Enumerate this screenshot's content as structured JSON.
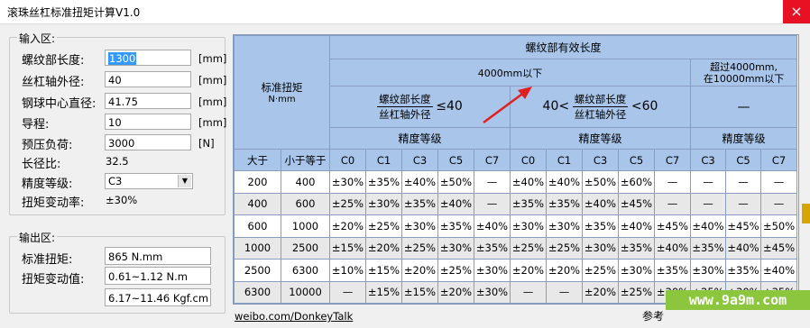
{
  "window": {
    "title": "滚珠丝杠标准扭矩计算V1.0",
    "close": "×"
  },
  "input_section": {
    "legend": "输入区:",
    "rows": [
      {
        "label": "螺纹部长度:",
        "value": "1300",
        "unit": "[mm]"
      },
      {
        "label": "丝杠轴外径:",
        "value": "40",
        "unit": "[mm]"
      },
      {
        "label": "钢球中心直径:",
        "value": "41.75",
        "unit": "[mm]"
      },
      {
        "label": "导程:",
        "value": "10",
        "unit": "[mm]"
      },
      {
        "label": "预压负荷:",
        "value": "3000",
        "unit": "[N]"
      }
    ],
    "ratio_label": "长径比:",
    "ratio_value": "32.5",
    "grade_label": "精度等级:",
    "grade_value": "C3",
    "torque_var_label": "扭矩变动率:",
    "torque_var_value": "±30%"
  },
  "output_section": {
    "legend": "输出区:",
    "std_torque_label": "标准扭矩:",
    "std_torque_value": "865 N.mm",
    "torque_range_label": "扭矩变动值:",
    "torque_range_value": "0.61~1.12 N.m",
    "torque_range_value2": "6.17~11.46 Kgf.cm"
  },
  "table": {
    "std_torque_head": "标准扭矩",
    "std_torque_unit": "N·mm",
    "effective_length": "螺纹部有效长度",
    "under_4000": "4000mm以下",
    "over_4000_line1": "超过4000mm,",
    "over_4000_line2": "在10000mm以下",
    "frac_num": "螺纹部长度",
    "frac_den": "丝杠轴外径",
    "le40": "≤40",
    "lt60_prefix": "40<",
    "lt60_suffix": "<60",
    "dash_header": "—",
    "precision": "精度等级",
    "greater": "大于",
    "less_equal": "小于等于",
    "grades1": [
      "C0",
      "C1",
      "C3",
      "C5",
      "C7"
    ],
    "grades2": [
      "C0",
      "C1",
      "C3",
      "C5",
      "C7"
    ],
    "grades3": [
      "C3",
      "C5",
      "C7"
    ],
    "rows": [
      {
        "gt": "200",
        "le": "400",
        "a": [
          "±30%",
          "±35%",
          "±40%",
          "±50%",
          "—"
        ],
        "b": [
          "±40%",
          "±40%",
          "±50%",
          "±60%",
          "—"
        ],
        "c": [
          "—",
          "—",
          "—"
        ]
      },
      {
        "gt": "400",
        "le": "600",
        "a": [
          "±25%",
          "±30%",
          "±35%",
          "±40%",
          "—"
        ],
        "b": [
          "±35%",
          "±35%",
          "±40%",
          "±45%",
          "—"
        ],
        "c": [
          "—",
          "—",
          "—"
        ]
      },
      {
        "gt": "600",
        "le": "1000",
        "a": [
          "±20%",
          "±25%",
          "±30%",
          "±35%",
          "±40%"
        ],
        "b": [
          "±30%",
          "±30%",
          "±35%",
          "±40%",
          "±45%"
        ],
        "c": [
          "±40%",
          "±45%",
          "±50%"
        ]
      },
      {
        "gt": "1000",
        "le": "2500",
        "a": [
          "±15%",
          "±20%",
          "±25%",
          "±30%",
          "±35%"
        ],
        "b": [
          "±25%",
          "±25%",
          "±30%",
          "±35%",
          "±40%"
        ],
        "c": [
          "±35%",
          "±40%",
          "±45%"
        ]
      },
      {
        "gt": "2500",
        "le": "6300",
        "a": [
          "±10%",
          "±15%",
          "±20%",
          "±25%",
          "±30%"
        ],
        "b": [
          "±20%",
          "±20%",
          "±25%",
          "±30%",
          "±35%"
        ],
        "c": [
          "±30%",
          "±35%",
          "±40%"
        ]
      },
      {
        "gt": "6300",
        "le": "10000",
        "a": [
          "—",
          "±15%",
          "±15%",
          "±20%",
          "±30%"
        ],
        "b": [
          "—",
          "—",
          "±20%",
          "±25%",
          "±30%"
        ],
        "c": [
          "±25%",
          "±30%",
          "±35%"
        ]
      }
    ]
  },
  "footer": {
    "link": "weibo.com/DonkeyTalk",
    "ref": "参考"
  },
  "watermark": "www.9a9m.com",
  "colors": {
    "header_blue": "#a9c6ea",
    "arrow_red": "#e0201e",
    "close_red": "#e81123",
    "watermark_green": "#8cc63f"
  }
}
